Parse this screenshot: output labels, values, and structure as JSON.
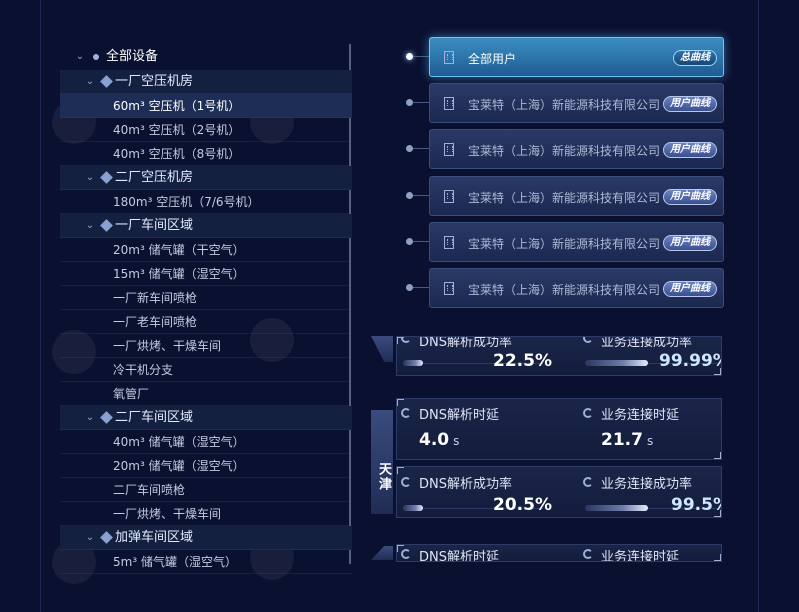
{
  "tree": {
    "root": "全部设备",
    "groups": [
      {
        "label": "一厂空压机房",
        "items": [
          "60m³ 空压机（1号机）",
          "40m³ 空压机（2号机）",
          "40m³ 空压机（8号机）"
        ]
      },
      {
        "label": "二厂空压机房",
        "items": [
          "180m³ 空压机（7/6号机）"
        ]
      },
      {
        "label": "一厂车间区域",
        "items": [
          "20m³ 储气罐（干空气）",
          "15m³ 储气罐（湿空气）",
          "一厂新车间喷枪",
          "一厂老车间喷枪",
          "一厂烘烤、干燥车间",
          "冷干机分支",
          "氧管厂"
        ]
      },
      {
        "label": "二厂车间区域",
        "items": [
          "40m³ 储气罐（湿空气）",
          "20m³ 储气罐（湿空气）",
          "二厂车间喷枪",
          "一厂烘烤、干燥车间"
        ]
      },
      {
        "label": "加弹车间区域",
        "items": [
          "5m³ 储气罐（湿空气）"
        ]
      }
    ],
    "selected": "60m³ 空压机（1号机）"
  },
  "users": {
    "all_label": "全部用户",
    "all_button": "总曲线",
    "items": [
      {
        "name": "宝莱特（上海）新能源科技有限公司",
        "button": "用户曲线"
      },
      {
        "name": "宝莱特（上海）新能源科技有限公司",
        "button": "用户曲线"
      },
      {
        "name": "宝莱特（上海）新能源科技有限公司",
        "button": "用户曲线"
      },
      {
        "name": "宝莱特（上海）新能源科技有限公司",
        "button": "用户曲线"
      },
      {
        "name": "宝莱特（上海）新能源科技有限公司",
        "button": "用户曲线"
      }
    ]
  },
  "metrics": {
    "top": {
      "left_label": "DNS解析成功率",
      "left_value": "22.5%",
      "left_progress": 0.225,
      "right_label": "业务连接成功率",
      "right_value": "99.99%",
      "right_progress": 0.9999
    },
    "tianjin": {
      "city": "天津",
      "row1": {
        "left_label": "DNS解析时延",
        "left_value": "4.0",
        "left_unit": "s",
        "right_label": "业务连接时延",
        "right_value": "21.7",
        "right_unit": "s"
      },
      "row2": {
        "left_label": "DNS解析成功率",
        "left_value": "20.5%",
        "left_progress": 0.205,
        "right_label": "业务连接成功率",
        "right_value": "99.5%",
        "right_progress": 0.995
      }
    },
    "bottom": {
      "left_label": "DNS解析时延",
      "right_label": "业务连接时延"
    }
  },
  "colors": {
    "background": "#0a1030",
    "accent": "#3b8ec2",
    "panel": "#1a2548"
  }
}
